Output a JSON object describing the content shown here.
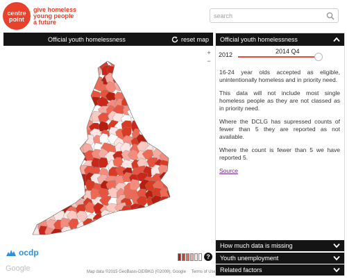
{
  "header": {
    "logo_line1": "centre",
    "logo_line2": "point",
    "tagline": [
      "give homeless",
      "young people",
      "a future"
    ],
    "search_placeholder": "search"
  },
  "map": {
    "title": "Official youth homelessness",
    "reset_label": "reset map",
    "zoom_in": "+",
    "zoom_out": "−",
    "legend_colors": [
      "#b51f10",
      "#d83a24",
      "#ee6a55",
      "#f7aaa0",
      "#fce5e2",
      "#ffffff"
    ],
    "help": "?",
    "ocdp_label": "ocdp",
    "google_label": "Google",
    "attribution": [
      "Map data ©2015 GeoBasis-DE/BKG (©2009), Google",
      "Terms of Use"
    ],
    "region_colors": [
      "#b51f10",
      "#c9271a",
      "#d83a24",
      "#e8533f",
      "#ee6a55",
      "#f48b7c",
      "#f7aaa0",
      "#fbc8c1",
      "#fce5e2",
      "#ffffff"
    ]
  },
  "side": {
    "title": "Official youth homelessness",
    "year": "2012",
    "slider_value": "2014 Q4",
    "paragraphs": [
      "16-24 year olds accepted as eligible, unintentionally homeless and in priority need.",
      "This data will not include most single homeless people as they are not classed as in priority need.",
      "Where the DCLG has supressed counts of fewer than 5 they are reported as not available.",
      "Where the count is fewer than 5 we have reported 5."
    ],
    "source_label": "Source",
    "accordions": [
      "How much data is missing",
      "Youth unemployment",
      "Related factors"
    ]
  }
}
